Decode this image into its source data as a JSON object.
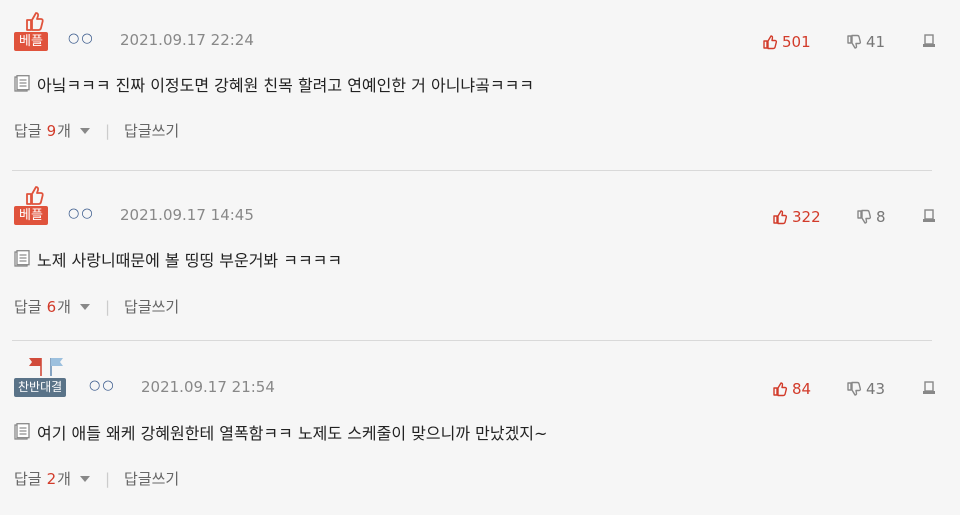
{
  "comments": [
    {
      "badge": "베플",
      "badge_type": "best",
      "writer": "○○",
      "time": "2021.09.17 22:24",
      "upvotes": "501",
      "downvotes": "41",
      "text": "아닠ㅋㅋㅋ 진짜 이정도면 강혜원 친목 할려고 연예인한 거 아니냐곸ㅋㅋㅋ",
      "reply_label": "답글",
      "reply_count": "9",
      "reply_unit": "개",
      "write_label": "답글쓰기"
    },
    {
      "badge": "베플",
      "badge_type": "best",
      "writer": "○○",
      "time": "2021.09.17 14:45",
      "upvotes": "322",
      "downvotes": "8",
      "text": "노제 사랑니때문에 볼 띵띵 부운거봐 ㅋㅋㅋㅋ",
      "reply_label": "답글",
      "reply_count": "6",
      "reply_unit": "개",
      "write_label": "답글쓰기"
    },
    {
      "badge": "찬반대결",
      "badge_type": "vs",
      "writer": "○○",
      "time": "2021.09.17 21:54",
      "upvotes": "84",
      "downvotes": "43",
      "text": "여기 애들 왜케 강혜원한테 열폭함ㅋㅋ 노제도 스케줄이 맞으니까 만났겠지~",
      "reply_label": "답글",
      "reply_count": "2",
      "reply_unit": "개",
      "write_label": "답글쓰기"
    }
  ],
  "colors": {
    "best_badge": "#e0533c",
    "vs_badge": "#5a7388",
    "upvote": "#d23b2a",
    "downvote": "#777777",
    "reply_count": "#d23b2a"
  }
}
